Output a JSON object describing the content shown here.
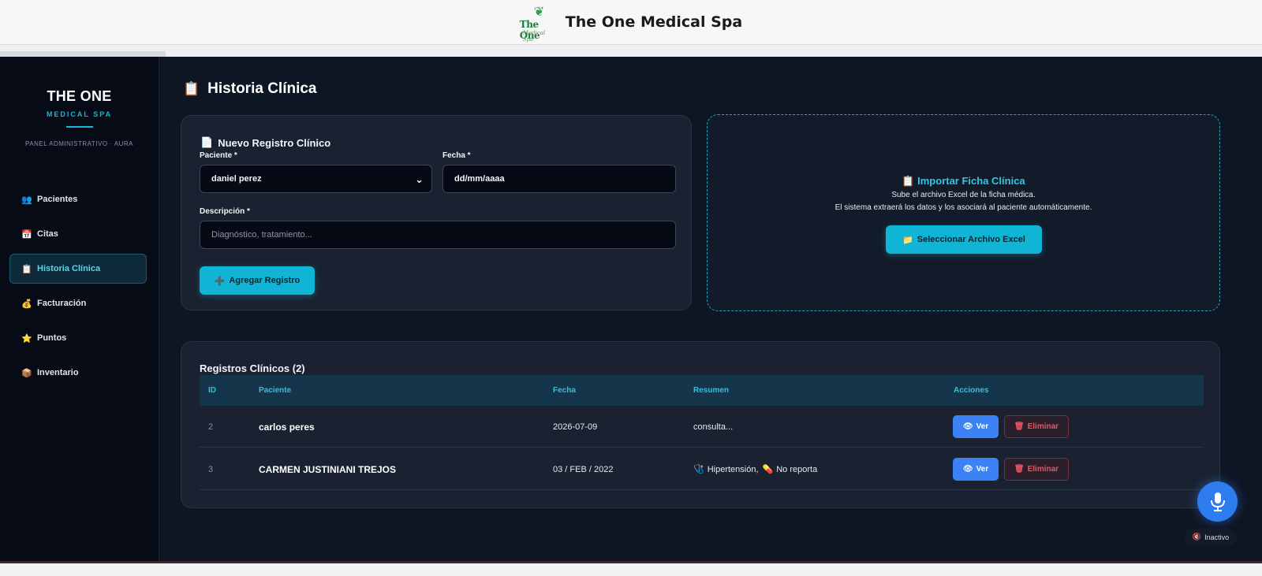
{
  "header": {
    "logo_line1": "The One",
    "logo_line2": "Medical Spa",
    "title": "The One Medical Spa"
  },
  "sidebar": {
    "brand": "THE ONE",
    "brand_sub": "MEDICAL SPA",
    "panel": "PANEL ADMINISTRATIVO · AURA",
    "items": [
      {
        "label": "Pacientes",
        "icon": "👥",
        "active": false
      },
      {
        "label": "Citas",
        "icon": "📅",
        "active": false
      },
      {
        "label": "Historia Clínica",
        "icon": "📋",
        "active": true
      },
      {
        "label": "Facturación",
        "icon": "💰",
        "active": false
      },
      {
        "label": "Puntos",
        "icon": "⭐",
        "active": false
      },
      {
        "label": "Inventario",
        "icon": "📦",
        "active": false
      }
    ]
  },
  "page": {
    "title": "Historia Clínica",
    "title_icon": "📋"
  },
  "form": {
    "title": "Nuevo Registro Clínico",
    "title_icon": "📄",
    "patient_label": "Paciente *",
    "patient_value": "daniel perez",
    "date_label": "Fecha *",
    "date_placeholder": "dd/mm/aaaa",
    "desc_label": "Descripción *",
    "desc_placeholder": "Diagnóstico, tratamiento...",
    "add_button": "Agregar Registro",
    "add_icon": "➕"
  },
  "import": {
    "title": "Importar Ficha Clínica",
    "icon": "📋",
    "line1": "Sube el archivo Excel de la ficha médica.",
    "line2": "El sistema extraerá los datos y los asociará al paciente automáticamente.",
    "button": "Seleccionar Archivo Excel",
    "button_icon": "📁"
  },
  "records": {
    "title": "Registros Clínicos (2)",
    "columns": [
      "ID",
      "Paciente",
      "Fecha",
      "Resumen",
      "Acciones"
    ],
    "rows": [
      {
        "id": "2",
        "patient": "carlos peres",
        "date": "2026-07-09",
        "summary": "consulta...",
        "summary_icon1": "",
        "summary_icon2": "",
        "summary2": ""
      },
      {
        "id": "3",
        "patient": "CARMEN JUSTINIANI TREJOS",
        "date": "03 / FEB / 2022",
        "summary": "Hipertensión,",
        "summary_icon1": "🩺",
        "summary_icon2": "💊",
        "summary2": "No reporta"
      }
    ],
    "view_label": "Ver",
    "view_icon": "👁",
    "delete_label": "Eliminar",
    "delete_icon": "🗑"
  },
  "voice": {
    "status": "Inactivo",
    "status_icon": "🔇"
  },
  "colors": {
    "accent": "#10b5d6",
    "primary_blue": "#3c82f5",
    "danger": "#ef5363"
  }
}
